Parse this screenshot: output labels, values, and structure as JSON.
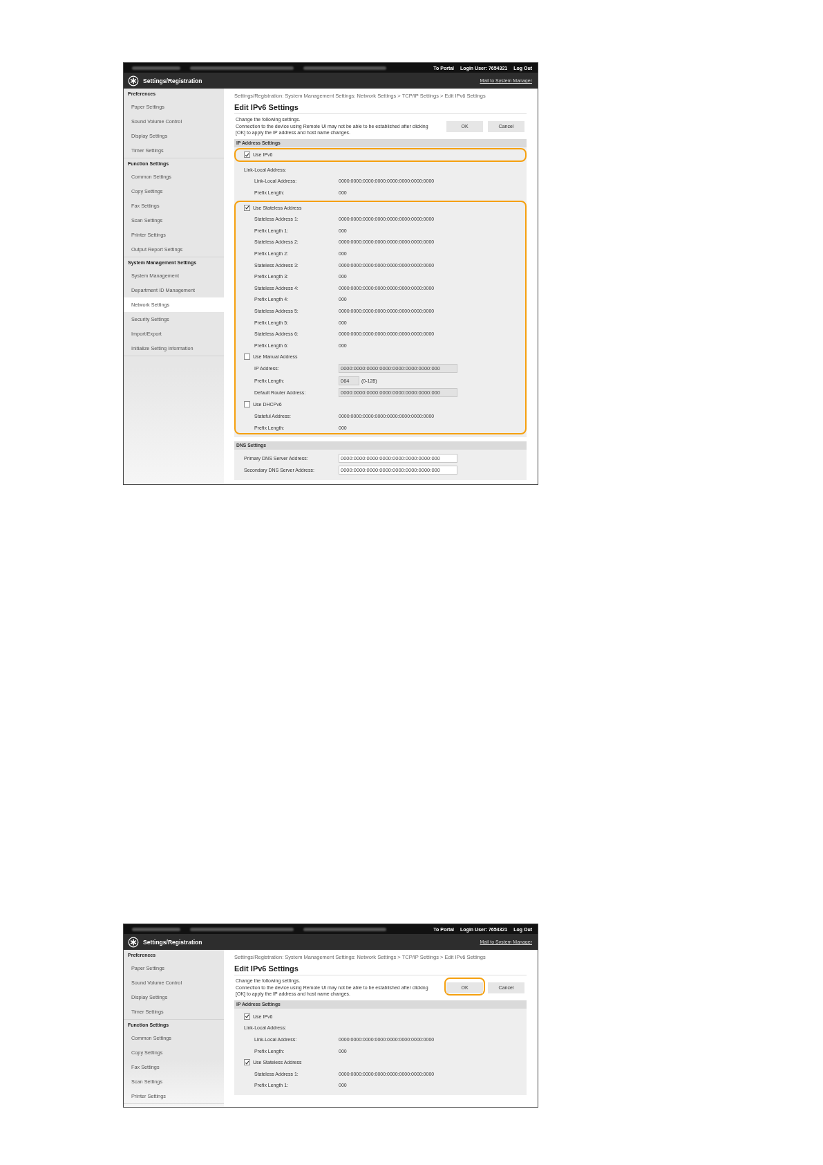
{
  "screenshots": [
    {
      "top_bar": {
        "links": [
          "To Portal",
          "Login User: 7654321",
          "Log Out"
        ]
      },
      "header": {
        "title": "Settings/Registration",
        "link": "Mail to System Manager"
      },
      "sidebar": [
        {
          "heading": "Preferences",
          "items": [
            {
              "label": "Paper Settings",
              "selected": false
            },
            {
              "label": "Sound Volume Control",
              "selected": false
            },
            {
              "label": "Display Settings",
              "selected": false
            },
            {
              "label": "Timer Settings",
              "selected": false
            }
          ]
        },
        {
          "heading": "Function Settings",
          "items": [
            {
              "label": "Common Settings",
              "selected": false
            },
            {
              "label": "Copy Settings",
              "selected": false
            },
            {
              "label": "Fax Settings",
              "selected": false
            },
            {
              "label": "Scan Settings",
              "selected": false
            },
            {
              "label": "Printer Settings",
              "selected": false
            },
            {
              "label": "Output Report Settings",
              "selected": false
            }
          ]
        },
        {
          "heading": "System Management Settings",
          "items": [
            {
              "label": "System Management",
              "selected": false
            },
            {
              "label": "Department ID Management",
              "selected": false
            },
            {
              "label": "Network Settings",
              "selected": true
            },
            {
              "label": "Security Settings",
              "selected": false
            },
            {
              "label": "Import/Export",
              "selected": false
            },
            {
              "label": "Initialize Setting Information",
              "selected": false
            }
          ]
        }
      ],
      "breadcrumb": "Settings/Registration: System Management Settings: Network Settings > TCP/IP Settings > Edit IPv6 Settings",
      "page_title": "Edit IPv6 Settings",
      "description": [
        "Change the following settings.",
        "Connection to the device using Remote UI may not be able to be established after clicking [OK] to apply the IP address and host name changes."
      ],
      "buttons": [
        {
          "label": "OK",
          "highlighted": false
        },
        {
          "label": "Cancel",
          "highlighted": false
        }
      ],
      "sections": [
        {
          "title": "IP Address Settings",
          "groups": [
            {
              "highlighted": true,
              "rows": [
                {
                  "kind": "checkbox",
                  "label": "Use IPv6",
                  "checked": true
                }
              ]
            },
            {
              "highlighted": false,
              "rows": [
                {
                  "kind": "heading",
                  "label": "Link-Local Address:",
                  "children": [
                    {
                      "kind": "value",
                      "label": "Link-Local Address:",
                      "value": "0000:0000:0000:0000:0000:0000:0000:0000"
                    },
                    {
                      "kind": "value",
                      "label": "Prefix Length:",
                      "value": "000"
                    }
                  ]
                }
              ]
            },
            {
              "highlighted": true,
              "rows": [
                {
                  "kind": "checkbox",
                  "label": "Use Stateless Address",
                  "checked": true,
                  "children": [
                    {
                      "kind": "value",
                      "label": "Stateless Address 1:",
                      "value": "0000:0000:0000:0000:0000:0000:0000:0000"
                    },
                    {
                      "kind": "value",
                      "label": "Prefix Length 1:",
                      "value": "000"
                    },
                    {
                      "kind": "value",
                      "label": "Stateless Address 2:",
                      "value": "0000:0000:0000:0000:0000:0000:0000:0000"
                    },
                    {
                      "kind": "value",
                      "label": "Prefix Length 2:",
                      "value": "000"
                    },
                    {
                      "kind": "value",
                      "label": "Stateless Address 3:",
                      "value": "0000:0000:0000:0000:0000:0000:0000:0000"
                    },
                    {
                      "kind": "value",
                      "label": "Prefix Length 3:",
                      "value": "000"
                    },
                    {
                      "kind": "value",
                      "label": "Stateless Address 4:",
                      "value": "0000:0000:0000:0000:0000:0000:0000:0000"
                    },
                    {
                      "kind": "value",
                      "label": "Prefix Length 4:",
                      "value": "000"
                    },
                    {
                      "kind": "value",
                      "label": "Stateless Address 5:",
                      "value": "0000:0000:0000:0000:0000:0000:0000:0000"
                    },
                    {
                      "kind": "value",
                      "label": "Prefix Length 5:",
                      "value": "000"
                    },
                    {
                      "kind": "value",
                      "label": "Stateless Address 6:",
                      "value": "0000:0000:0000:0000:0000:0000:0000:0000"
                    },
                    {
                      "kind": "value",
                      "label": "Prefix Length 6:",
                      "value": "000"
                    }
                  ]
                },
                {
                  "kind": "checkbox",
                  "label": "Use Manual Address",
                  "checked": false,
                  "children": [
                    {
                      "kind": "input",
                      "label": "IP Address:",
                      "value": "0000:0000:0000:0000:0000:0000:0000:000",
                      "disabled": true
                    },
                    {
                      "kind": "input",
                      "label": "Prefix Length:",
                      "value": "064",
                      "suffix": "(0-128)",
                      "disabled": true
                    },
                    {
                      "kind": "input",
                      "label": "Default Router Address:",
                      "value": "0000:0000:0000:0000:0000:0000:0000:000",
                      "disabled": true
                    }
                  ]
                },
                {
                  "kind": "checkbox",
                  "label": "Use DHCPv6",
                  "checked": false,
                  "children": [
                    {
                      "kind": "value",
                      "label": "Stateful Address:",
                      "value": "0000:0000:0000:0000:0000:0000:0000:0000"
                    },
                    {
                      "kind": "value",
                      "label": "Prefix Length:",
                      "value": "000"
                    }
                  ]
                }
              ]
            }
          ]
        },
        {
          "title": "DNS Settings",
          "groups": [
            {
              "highlighted": false,
              "rows": [
                {
                  "kind": "input",
                  "label": "Primary DNS Server Address:",
                  "value": "0000:0000:0000:0000:0000:0000:0000:000",
                  "disabled": false
                },
                {
                  "kind": "input",
                  "label": "Secondary DNS Server Address:",
                  "value": "0000:0000:0000:0000:0000:0000:0000:000",
                  "disabled": false
                }
              ]
            }
          ]
        }
      ]
    },
    {
      "top_bar": {
        "links": [
          "To Portal",
          "Login User: 7654321",
          "Log Out"
        ]
      },
      "header": {
        "title": "Settings/Registration",
        "link": "Mail to System Manager"
      },
      "sidebar": [
        {
          "heading": "Preferences",
          "items": [
            {
              "label": "Paper Settings",
              "selected": false
            },
            {
              "label": "Sound Volume Control",
              "selected": false
            },
            {
              "label": "Display Settings",
              "selected": false
            },
            {
              "label": "Timer Settings",
              "selected": false
            }
          ]
        },
        {
          "heading": "Function Settings",
          "items": [
            {
              "label": "Common Settings",
              "selected": false
            },
            {
              "label": "Copy Settings",
              "selected": false
            },
            {
              "label": "Fax Settings",
              "selected": false
            },
            {
              "label": "Scan Settings",
              "selected": false
            },
            {
              "label": "Printer Settings",
              "selected": false
            }
          ]
        }
      ],
      "breadcrumb": "Settings/Registration: System Management Settings: Network Settings > TCP/IP Settings > Edit IPv6 Settings",
      "page_title": "Edit IPv6 Settings",
      "description": [
        "Change the following settings.",
        "Connection to the device using Remote UI may not be able to be established after clicking [OK] to apply the IP address and host name changes."
      ],
      "buttons": [
        {
          "label": "OK",
          "highlighted": true
        },
        {
          "label": "Cancel",
          "highlighted": false
        }
      ],
      "sections": [
        {
          "title": "IP Address Settings",
          "groups": [
            {
              "highlighted": false,
              "rows": [
                {
                  "kind": "checkbox",
                  "label": "Use IPv6",
                  "checked": true
                },
                {
                  "kind": "heading",
                  "label": "Link-Local Address:",
                  "children": [
                    {
                      "kind": "value",
                      "label": "Link-Local Address:",
                      "value": "0000:0000:0000:0000:0000:0000:0000:0000"
                    },
                    {
                      "kind": "value",
                      "label": "Prefix Length:",
                      "value": "000"
                    }
                  ]
                },
                {
                  "kind": "checkbox",
                  "label": "Use Stateless Address",
                  "checked": true,
                  "children": [
                    {
                      "kind": "value",
                      "label": "Stateless Address 1:",
                      "value": "0000:0000:0000:0000:0000:0000:0000:0000"
                    },
                    {
                      "kind": "value",
                      "label": "Prefix Length 1:",
                      "value": "000"
                    }
                  ]
                }
              ]
            }
          ]
        }
      ]
    }
  ]
}
